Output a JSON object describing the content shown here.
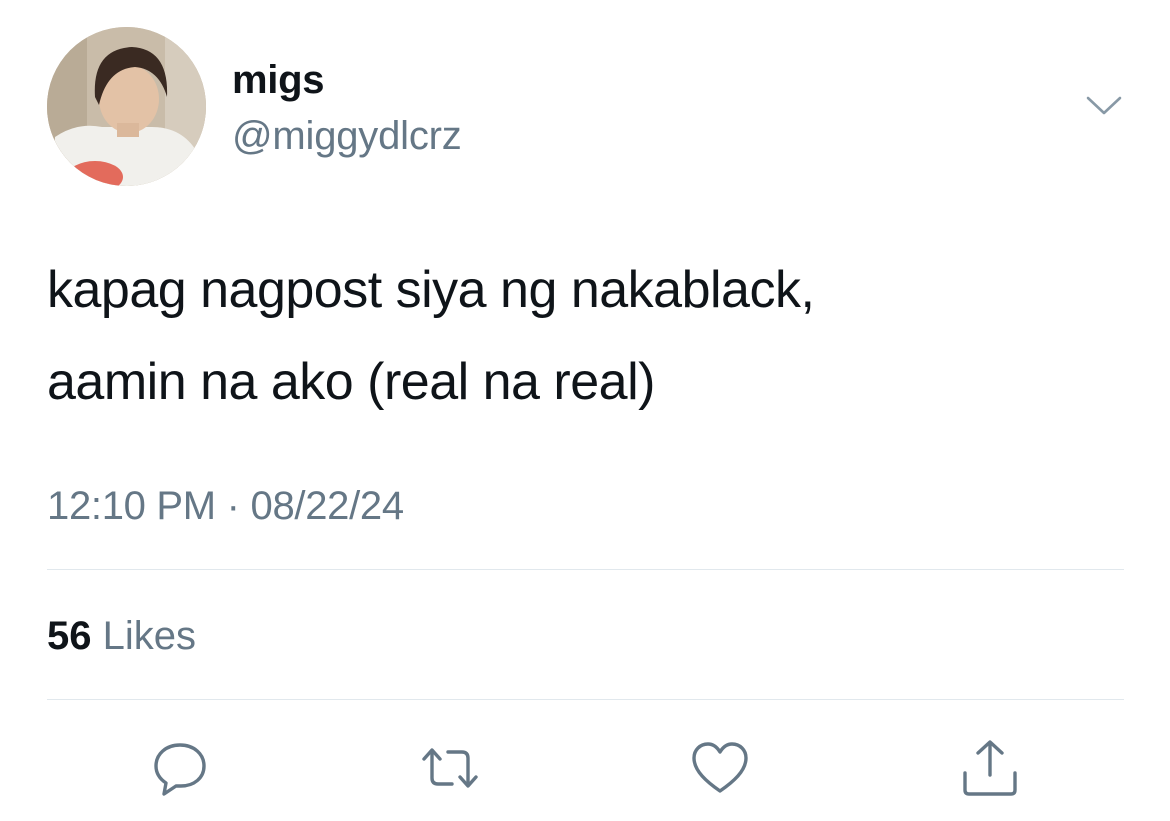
{
  "tweet": {
    "author": {
      "display_name": "migs",
      "handle": "@miggydlcrz"
    },
    "text_lines": [
      "kapag nagpost siya ng nakablack,",
      "aamin na ako (real na real)"
    ],
    "time": "12:10 PM",
    "separator": "·",
    "date": "08/22/24",
    "likes": {
      "count": "56",
      "label": "Likes"
    }
  },
  "icons": {
    "menu": "chevron-down-icon",
    "reply": "speech-bubble-icon",
    "retweet": "retweet-icon",
    "like": "heart-icon",
    "share": "share-icon"
  },
  "colors": {
    "text_primary": "#0f1419",
    "text_secondary": "#657786",
    "divider": "#e1e8ed",
    "icon": "#657786"
  }
}
